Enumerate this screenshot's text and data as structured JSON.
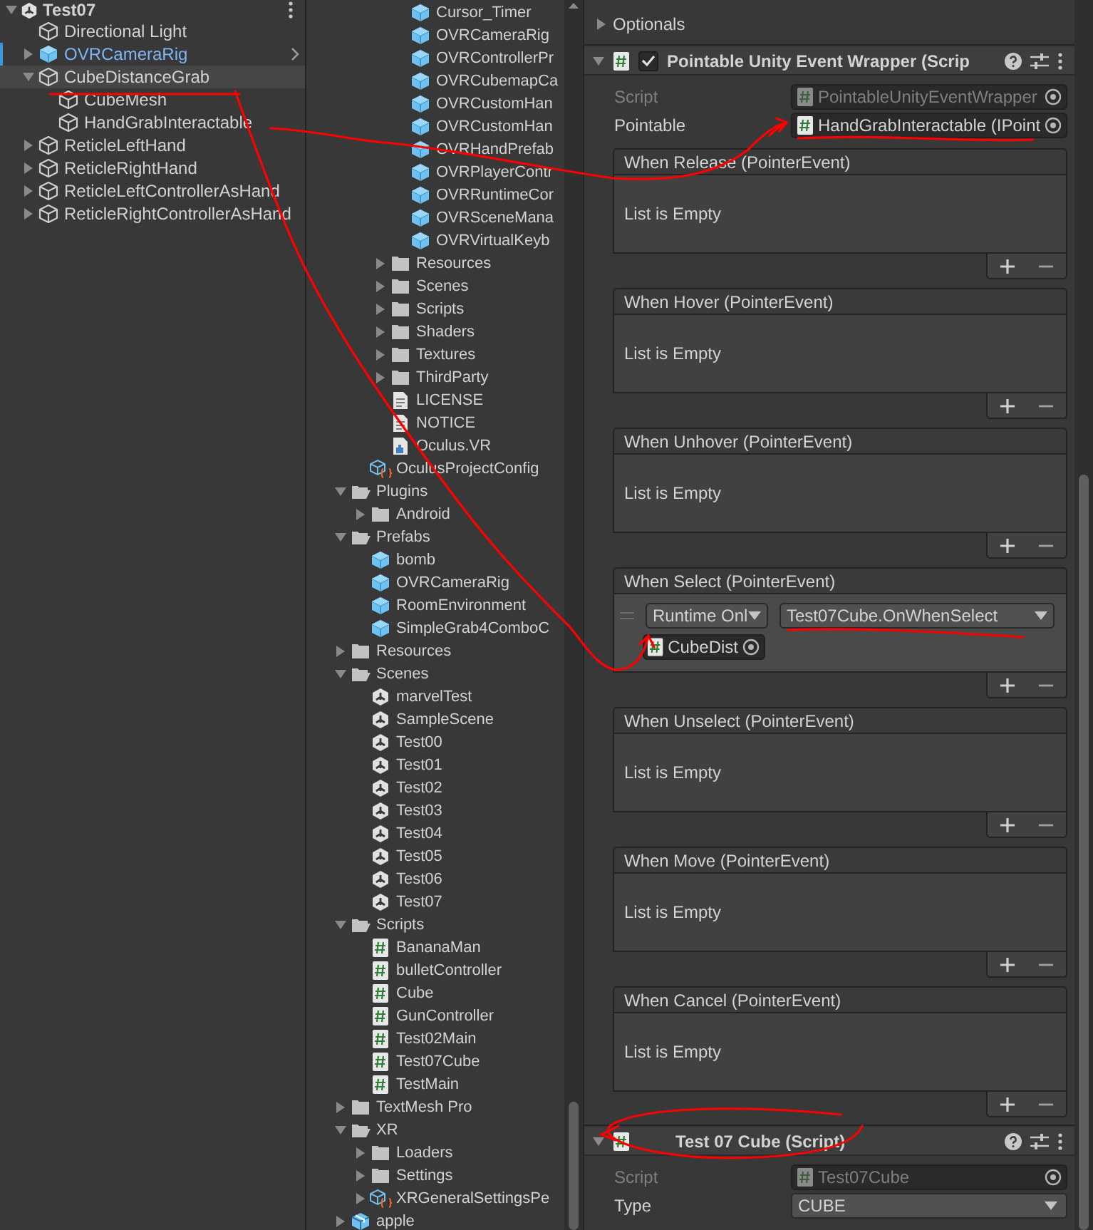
{
  "hierarchy": {
    "scene": "Test07",
    "items": [
      {
        "label": "Directional Light",
        "kind": "object",
        "selected": false
      },
      {
        "label": "OVRCameraRig",
        "kind": "prefab",
        "expanded": false,
        "selected": false
      },
      {
        "label": "CubeDistanceGrab",
        "kind": "object",
        "expanded": true,
        "selected": true,
        "children": [
          {
            "label": "CubeMesh",
            "kind": "object",
            "selected": false
          },
          {
            "label": "HandGrabInteractable",
            "kind": "object",
            "selected": false
          }
        ]
      },
      {
        "label": "ReticleLeftHand",
        "kind": "object",
        "expanded": false,
        "selected": false
      },
      {
        "label": "ReticleRightHand",
        "kind": "object",
        "expanded": false,
        "selected": false
      },
      {
        "label": "ReticleLeftControllerAsHand",
        "kind": "object",
        "expanded": false,
        "selected": false
      },
      {
        "label": "ReticleRightControllerAsHand",
        "kind": "object",
        "expanded": false,
        "selected": false
      }
    ]
  },
  "project": {
    "items": [
      {
        "children": [
          {
            "children": [
              {
                "children": [
                  {
                    "label": "Cursor_Timer",
                    "kind": "prefab"
                  },
                  {
                    "label": "OVRCameraRig",
                    "kind": "prefab"
                  },
                  {
                    "label": "OVRControllerPr",
                    "kind": "prefab"
                  },
                  {
                    "label": "OVRCubemapCa",
                    "kind": "prefab"
                  },
                  {
                    "label": "OVRCustomHan",
                    "kind": "prefab"
                  },
                  {
                    "label": "OVRCustomHan",
                    "kind": "prefab"
                  },
                  {
                    "label": "OVRHandPrefab",
                    "kind": "prefab"
                  },
                  {
                    "label": "OVRPlayerContr",
                    "kind": "prefab"
                  },
                  {
                    "label": "OVRRuntimeCor",
                    "kind": "prefab"
                  },
                  {
                    "label": "OVRSceneMana",
                    "kind": "prefab"
                  },
                  {
                    "label": "OVRVirtualKeyb",
                    "kind": "prefab"
                  }
                ]
              },
              {
                "label": "Resources",
                "kind": "folder",
                "expanded": false
              },
              {
                "label": "Scenes",
                "kind": "folder",
                "expanded": false
              },
              {
                "label": "Scripts",
                "kind": "folder",
                "expanded": false
              },
              {
                "label": "Shaders",
                "kind": "folder",
                "expanded": false
              },
              {
                "label": "Textures",
                "kind": "folder",
                "expanded": false
              },
              {
                "label": "ThirdParty",
                "kind": "folder",
                "expanded": false
              },
              {
                "label": "LICENSE",
                "kind": "text"
              },
              {
                "label": "NOTICE",
                "kind": "text"
              },
              {
                "label": "Oculus.VR",
                "kind": "assembly"
              }
            ]
          },
          {
            "label": "OculusProjectConfig",
            "kind": "config"
          }
        ]
      },
      {
        "label": "Plugins",
        "kind": "folder",
        "expanded": true,
        "children": [
          {
            "label": "Android",
            "kind": "folder",
            "expanded": false
          }
        ]
      },
      {
        "label": "Prefabs",
        "kind": "folder",
        "expanded": true,
        "children": [
          {
            "label": "bomb",
            "kind": "prefab"
          },
          {
            "label": "OVRCameraRig",
            "kind": "prefab"
          },
          {
            "label": "RoomEnvironment",
            "kind": "prefab"
          },
          {
            "label": "SimpleGrab4ComboC",
            "kind": "prefab"
          }
        ]
      },
      {
        "label": "Resources",
        "kind": "folder",
        "expanded": false
      },
      {
        "label": "Scenes",
        "kind": "folder",
        "expanded": true,
        "children": [
          {
            "label": "marvelTest",
            "kind": "scene"
          },
          {
            "label": "SampleScene",
            "kind": "scene"
          },
          {
            "label": "Test00",
            "kind": "scene"
          },
          {
            "label": "Test01",
            "kind": "scene"
          },
          {
            "label": "Test02",
            "kind": "scene"
          },
          {
            "label": "Test03",
            "kind": "scene"
          },
          {
            "label": "Test04",
            "kind": "scene"
          },
          {
            "label": "Test05",
            "kind": "scene"
          },
          {
            "label": "Test06",
            "kind": "scene"
          },
          {
            "label": "Test07",
            "kind": "scene"
          }
        ]
      },
      {
        "label": "Scripts",
        "kind": "folder",
        "expanded": true,
        "children": [
          {
            "label": "BananaMan",
            "kind": "script"
          },
          {
            "label": "bulletController",
            "kind": "script"
          },
          {
            "label": "Cube",
            "kind": "script"
          },
          {
            "label": "GunController",
            "kind": "script"
          },
          {
            "label": "Test02Main",
            "kind": "script"
          },
          {
            "label": "Test07Cube",
            "kind": "script"
          },
          {
            "label": "TestMain",
            "kind": "script"
          }
        ]
      },
      {
        "label": "TextMesh Pro",
        "kind": "folder",
        "expanded": false
      },
      {
        "label": "XR",
        "kind": "folder",
        "expanded": true,
        "children": [
          {
            "label": "Loaders",
            "kind": "folder",
            "expanded": false
          },
          {
            "label": "Settings",
            "kind": "folder",
            "expanded": false
          },
          {
            "label": "XRGeneralSettingsPe",
            "kind": "config",
            "expanded": false
          }
        ]
      },
      {
        "label": "apple",
        "kind": "package",
        "expanded": false
      }
    ]
  },
  "inspector": {
    "optionals": {
      "label": "Optionals",
      "expanded": false
    },
    "components": [
      {
        "title": "Pointable Unity Event Wrapper (Scrip",
        "enabled": true,
        "expanded": true,
        "fields": [
          {
            "label": "Script",
            "kind": "object",
            "value": "PointableUnityEventWrapper",
            "disabled": true
          },
          {
            "label": "Pointable",
            "kind": "object",
            "value": "HandGrabInteractable (IPoint",
            "disabled": false
          }
        ],
        "events": [
          {
            "title": "When Release (PointerEvent)",
            "empty_text": "List is Empty"
          },
          {
            "title": "When Hover (PointerEvent)",
            "empty_text": "List is Empty"
          },
          {
            "title": "When Unhover (PointerEvent)",
            "empty_text": "List is Empty"
          },
          {
            "title": "When Select (PointerEvent)",
            "entries": [
              {
                "mode": "Runtime Onl",
                "function": "Test07Cube.OnWhenSelect",
                "target": "CubeDist"
              }
            ]
          },
          {
            "title": "When Unselect (PointerEvent)",
            "empty_text": "List is Empty"
          },
          {
            "title": "When Move (PointerEvent)",
            "empty_text": "List is Empty"
          },
          {
            "title": "When Cancel (PointerEvent)",
            "empty_text": "List is Empty"
          }
        ]
      },
      {
        "title": "Test 07 Cube (Script)",
        "expanded": true,
        "fields": [
          {
            "label": "Script",
            "kind": "object",
            "value": "Test07Cube",
            "disabled": true
          },
          {
            "label": "Type",
            "kind": "dropdown",
            "value": "CUBE",
            "disabled": false
          }
        ]
      }
    ]
  }
}
